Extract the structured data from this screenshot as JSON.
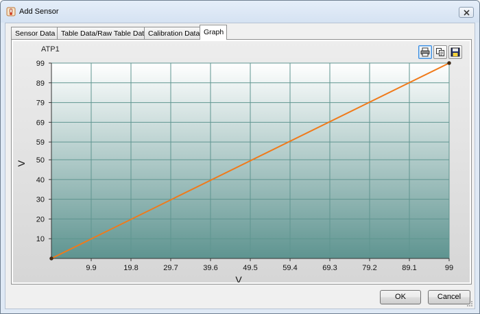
{
  "window": {
    "title": "Add Sensor"
  },
  "tabs": [
    {
      "label": "Sensor Data"
    },
    {
      "label": "Table Data/Raw Table Data"
    },
    {
      "label": "Calibration Data"
    },
    {
      "label": "Graph"
    }
  ],
  "active_tab": "Graph",
  "toolbar": {
    "icons": [
      "print-icon",
      "copy-icon",
      "save-icon"
    ]
  },
  "buttons": {
    "ok": "OK",
    "cancel": "Cancel"
  },
  "colors": {
    "line": "#f07a1a",
    "plot_top": "#ffffff",
    "plot_bottom": "#5e9490",
    "grid": "#5f9590"
  },
  "chart_data": {
    "type": "line",
    "title": "ATP1",
    "xlabel": "V",
    "ylabel": "V",
    "xlim": [
      0,
      99
    ],
    "ylim": [
      0,
      99
    ],
    "x_ticks": [
      "9.9",
      "19.8",
      "29.7",
      "39.6",
      "49.5",
      "59.4",
      "69.3",
      "79.2",
      "89.1",
      "99"
    ],
    "y_ticks": [
      "10",
      "20",
      "30",
      "40",
      "50",
      "59",
      "69",
      "79",
      "89",
      "99"
    ],
    "grid": true,
    "series": [
      {
        "x": [
          0,
          99
        ],
        "y": [
          0,
          99
        ]
      }
    ]
  }
}
